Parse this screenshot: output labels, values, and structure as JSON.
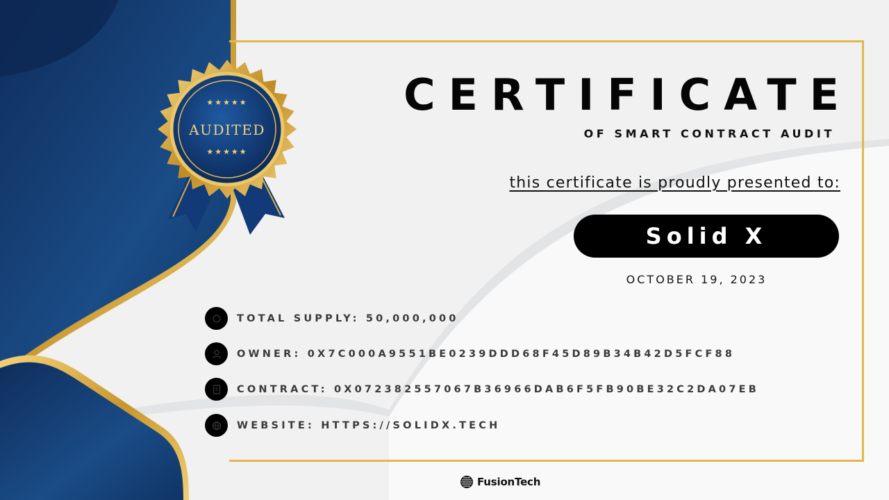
{
  "certificate": {
    "title": "CERTIFICATE",
    "subtitle": "OF SMART CONTRACT AUDIT",
    "presented_to_label": "this certificate is proudly presented to:",
    "recipient": "Solid X",
    "date": "OCTOBER 19, 2023"
  },
  "seal": {
    "text": "AUDITED",
    "stars_top": "★★★★★",
    "stars_bottom": "★★★★★"
  },
  "details": [
    {
      "icon": "supply-icon",
      "text": "TOTAL SUPPLY: 50,000,000"
    },
    {
      "icon": "owner-icon",
      "text": "OWNER: 0X7C000A9551BE0239DDD68F45D89B34B42D5FCF88"
    },
    {
      "icon": "contract-icon",
      "text": "CONTRACT: 0X072382557067B36966DAB6F5FB90BE32C2DA07EB"
    },
    {
      "icon": "website-icon",
      "text": "WEBSITE: HTTPS://SOLIDX.TECH"
    }
  ],
  "brand": {
    "name": "FusionTech"
  },
  "colors": {
    "navy": "#153a6e",
    "gold": "#e2b84a",
    "background": "#f2f2f3"
  }
}
